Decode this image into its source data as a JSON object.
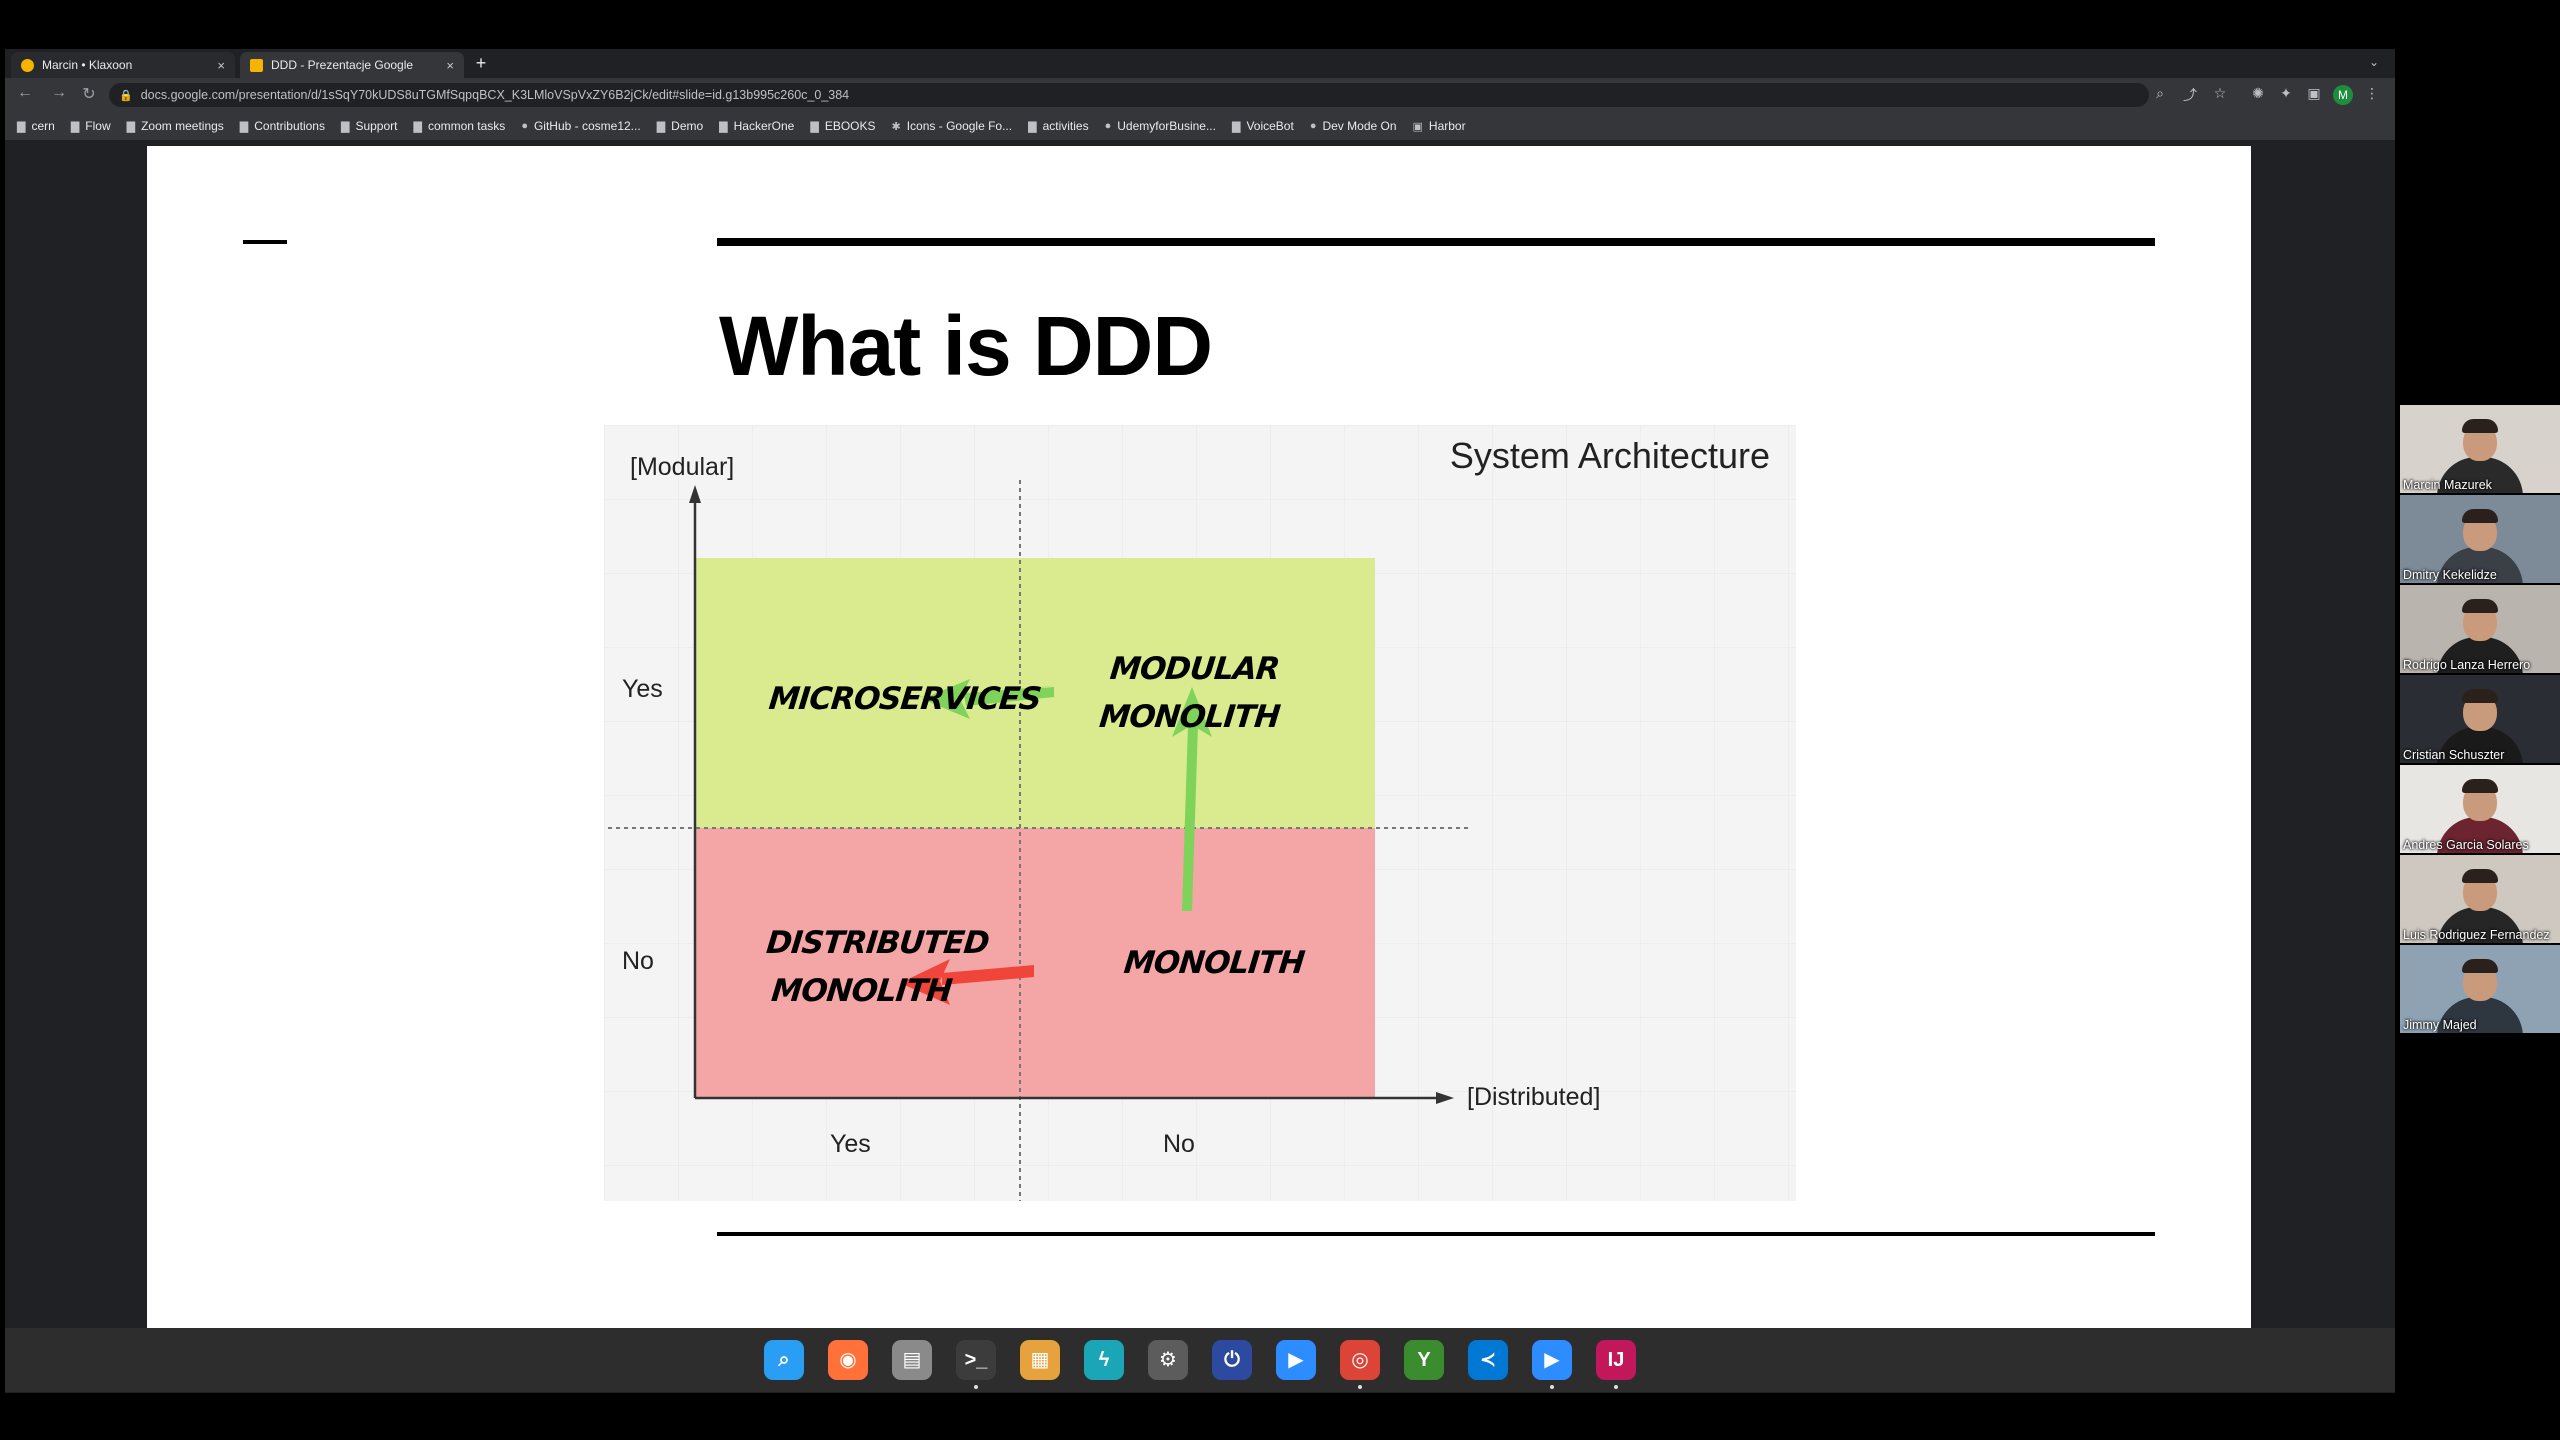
{
  "browser": {
    "tabs": [
      {
        "title": "Marcin • Klaxoon",
        "favicon_color": "#f4b400"
      },
      {
        "title": "DDD - Prezentacje Google",
        "favicon_color": "#f4b400"
      }
    ],
    "close_glyph": "×",
    "new_tab_glyph": "+",
    "tab_dropdown_glyph": "⌄",
    "url": "docs.google.com/presentation/d/1sSqY70kUDS8uTGMfSqpqBCX_K3LMloVSpVxZY6B2jCk/edit#slide=id.g13b995c260c_0_384",
    "nav_glyphs": {
      "back": "←",
      "forward": "→",
      "reload": "↻"
    },
    "lock_glyph": "🔒",
    "toolbar_glyphs": {
      "zoom": "⌕",
      "share": "⤴",
      "star": "☆",
      "ext": "✺",
      "puzzle": "✦",
      "sidepanel": "▣",
      "menu": "⋮"
    },
    "profile_initial": "M",
    "bookmarks": [
      {
        "label": "cern",
        "icon": "▇"
      },
      {
        "label": "Flow",
        "icon": "▇"
      },
      {
        "label": "Zoom meetings",
        "icon": "▇"
      },
      {
        "label": "Contributions",
        "icon": "▇"
      },
      {
        "label": "Support",
        "icon": "▇"
      },
      {
        "label": "common tasks",
        "icon": "▇"
      },
      {
        "label": "GitHub - cosme12...",
        "icon": "●"
      },
      {
        "label": "Demo",
        "icon": "▇"
      },
      {
        "label": "HackerOne",
        "icon": "▇"
      },
      {
        "label": "EBOOKS",
        "icon": "▇"
      },
      {
        "label": "Icons - Google Fo...",
        "icon": "✱"
      },
      {
        "label": "activities",
        "icon": "▇"
      },
      {
        "label": "UdemyforBusine...",
        "icon": "●"
      },
      {
        "label": "VoiceBot",
        "icon": "▇"
      },
      {
        "label": "Dev Mode On",
        "icon": "●"
      },
      {
        "label": "Harbor",
        "icon": "▣"
      }
    ]
  },
  "slide": {
    "title": "What is DDD",
    "diagram": {
      "title": "System Architecture",
      "y_axis_label": "[Modular]",
      "x_axis_label": "[Distributed]",
      "y_ticks": [
        "Yes",
        "No"
      ],
      "x_ticks": [
        "Yes",
        "No"
      ],
      "quadrants": {
        "top_left": "MICROSERVICES",
        "top_right": [
          "MODULAR",
          "MONOLITH"
        ],
        "bottom_left": [
          "DISTRIBUTED",
          "MONOLITH"
        ],
        "bottom_right": "MONOLITH"
      },
      "colors": {
        "top": "#d9ea8f",
        "bottom": "#f4a6a6",
        "green_arrow": "#7fd35a",
        "red_arrow": "#f0453a"
      }
    }
  },
  "participants": [
    {
      "name": "Marcin Mazurek",
      "bg": "#d8d2cc",
      "shirt": "#2a2a2a"
    },
    {
      "name": "Dmitry Kekelidze",
      "bg": "#7d8b99",
      "shirt": "#3b3f46"
    },
    {
      "name": "Rodrigo Lanza Herrero",
      "bg": "#b9b4ae",
      "shirt": "#1f1f1f"
    },
    {
      "name": "Cristian Schuszter",
      "bg": "#2a2d33",
      "shirt": "#1a1a1a"
    },
    {
      "name": "Andres Garcia Solares",
      "bg": "#e8e6e3",
      "shirt": "#6b2430"
    },
    {
      "name": "Luis Rodriguez Fernandez",
      "bg": "#cfc8c0",
      "shirt": "#262626"
    },
    {
      "name": "Jimmy Majed",
      "bg": "#8ea2b4",
      "shirt": "#2e3640"
    }
  ],
  "dock": [
    {
      "icon": "magnifier-app",
      "glyph": "⌕",
      "color": "#2a9df4",
      "running": false
    },
    {
      "icon": "firefox",
      "glyph": "◉",
      "color": "#ff7139",
      "running": false
    },
    {
      "icon": "files",
      "glyph": "▤",
      "color": "#8a8a8a",
      "running": false
    },
    {
      "icon": "terminal",
      "glyph": ">_",
      "color": "#3c3c3c",
      "running": true
    },
    {
      "icon": "archive-manager",
      "glyph": "▦",
      "color": "#e6a23c",
      "running": false
    },
    {
      "icon": "bolt-app",
      "glyph": "ϟ",
      "color": "#1aa6b7",
      "running": false
    },
    {
      "icon": "settings",
      "glyph": "⚙",
      "color": "#5c5c5c",
      "running": false
    },
    {
      "icon": "power-app",
      "glyph": "⏻",
      "color": "#2b4aa0",
      "running": false
    },
    {
      "icon": "zoom",
      "glyph": "▶",
      "color": "#2d8cff",
      "running": false
    },
    {
      "icon": "chrome",
      "glyph": "◎",
      "color": "#db4437",
      "running": true
    },
    {
      "icon": "y-app",
      "glyph": "Y",
      "color": "#3b8c2f",
      "running": false
    },
    {
      "icon": "vscode",
      "glyph": "≺",
      "color": "#0078d4",
      "running": false
    },
    {
      "icon": "zoom-meeting",
      "glyph": "▶",
      "color": "#2d8cff",
      "running": true
    },
    {
      "icon": "intellij",
      "glyph": "IJ",
      "color": "#c2185b",
      "running": true
    }
  ]
}
